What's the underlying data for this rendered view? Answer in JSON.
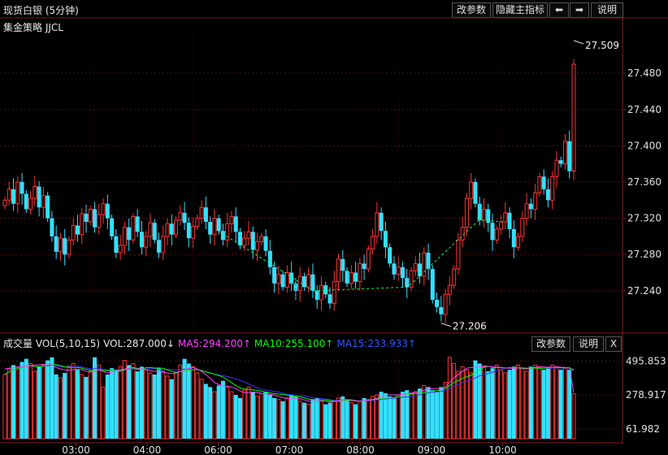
{
  "header": {
    "title": "现货白银 (5分钟)",
    "strategy": "集金策略 JJCL",
    "buttons": {
      "change_params": "改参数",
      "hide_indicator": "隐藏主指标",
      "prev": "⬅",
      "next": "➡",
      "help": "说明"
    }
  },
  "volume_header": {
    "label": "成交量 VOL(5,10,15)",
    "vol": "VOL:287.000↓",
    "ma5": "MA5:294.200↑",
    "ma10": "MA10:255.100↑",
    "ma15": "MA15:233.933↑",
    "buttons": {
      "change_params": "改参数",
      "help": "说明",
      "close": "X"
    }
  },
  "colors": {
    "up": "#ff3333",
    "down": "#33e0ff",
    "ma5": "#ff40ff",
    "ma10": "#00ff00",
    "ma15": "#3333ff",
    "signal": "#00ff66"
  },
  "chart_data": [
    {
      "type": "candlestick",
      "title": "现货白银 (5分钟)",
      "y_ticks": [
        "27.480",
        "27.440",
        "27.400",
        "27.360",
        "27.320",
        "27.280",
        "27.240"
      ],
      "ylim": [
        27.195,
        27.525
      ],
      "high_label": "27.509",
      "low_label": "27.206",
      "x_ticks": [
        "03:00",
        "04:00",
        "06:00",
        "07:00",
        "08:00",
        "09:00",
        "10:00"
      ],
      "close": [
        27.34,
        27.352,
        27.336,
        27.36,
        27.347,
        27.33,
        27.342,
        27.355,
        27.332,
        27.345,
        27.32,
        27.3,
        27.283,
        27.298,
        27.28,
        27.296,
        27.312,
        27.302,
        27.325,
        27.316,
        27.33,
        27.31,
        27.324,
        27.336,
        27.32,
        27.3,
        27.282,
        27.29,
        27.31,
        27.296,
        27.322,
        27.305,
        27.288,
        27.3,
        27.315,
        27.296,
        27.282,
        27.3,
        27.314,
        27.302,
        27.318,
        27.326,
        27.315,
        27.298,
        27.311,
        27.32,
        27.332,
        27.316,
        27.302,
        27.32,
        27.306,
        27.296,
        27.314,
        27.322,
        27.305,
        27.29,
        27.298,
        27.305,
        27.285,
        27.294,
        27.3,
        27.284,
        27.266,
        27.248,
        27.258,
        27.244,
        27.26,
        27.248,
        27.24,
        27.256,
        27.244,
        27.258,
        27.24,
        27.23,
        27.246,
        27.236,
        27.226,
        27.25,
        27.275,
        27.262,
        27.248,
        27.26,
        27.25,
        27.27,
        27.264,
        27.286,
        27.3,
        27.326,
        27.306,
        27.288,
        27.27,
        27.258,
        27.266,
        27.254,
        27.244,
        27.262,
        27.27,
        27.256,
        27.282,
        27.264,
        27.23,
        27.222,
        27.214,
        27.236,
        27.246,
        27.264,
        27.296,
        27.31,
        27.342,
        27.36,
        27.336,
        27.318,
        27.33,
        27.315,
        27.296,
        27.308,
        27.316,
        27.326,
        27.308,
        27.288,
        27.3,
        27.32,
        27.336,
        27.33,
        27.348,
        27.366,
        27.352,
        27.34,
        27.366,
        27.384,
        27.38,
        27.405,
        27.372,
        27.49
      ],
      "volume": {
        "y_ticks": [
          "495.853",
          "278.917",
          "61.982"
        ],
        "ylim": [
          0,
          560
        ],
        "values": [
          410,
          445,
          470,
          455,
          490,
          510,
          480,
          430,
          460,
          470,
          500,
          520,
          410,
          390,
          420,
          465,
          480,
          440,
          410,
          395,
          430,
          520,
          470,
          330,
          410,
          450,
          440,
          460,
          500,
          470,
          480,
          430,
          460,
          440,
          420,
          410,
          450,
          430,
          400,
          380,
          420,
          470,
          510,
          480,
          460,
          420,
          380,
          350,
          330,
          300,
          340,
          370,
          330,
          300,
          280,
          260,
          310,
          330,
          300,
          270,
          290,
          300,
          280,
          260,
          250,
          240,
          260,
          280,
          270,
          240,
          230,
          220,
          250,
          260,
          240,
          220,
          230,
          240,
          260,
          270,
          250,
          230,
          220,
          240,
          260,
          250,
          270,
          280,
          300,
          290,
          270,
          260,
          280,
          300,
          310,
          290,
          300,
          320,
          340,
          330,
          310,
          300,
          330,
          360,
          520,
          480,
          430,
          460,
          440,
          420,
          500,
          480,
          460,
          430,
          450,
          470,
          440,
          420,
          440,
          460,
          470,
          450,
          430,
          460,
          470,
          460,
          440,
          450,
          470,
          460,
          440,
          450,
          440,
          287
        ],
        "ma5": [
          445,
          450,
          455,
          458,
          460,
          462,
          465,
          470,
          472,
          475,
          478,
          470,
          455,
          445,
          440,
          438,
          440,
          445,
          440,
          430,
          425,
          430,
          440,
          430,
          420,
          425,
          430,
          440,
          445,
          450,
          455,
          450,
          445,
          440,
          435,
          430,
          428,
          425,
          420,
          415,
          418,
          428,
          440,
          450,
          455,
          445,
          430,
          410,
          385,
          360,
          345,
          340,
          335,
          330,
          320,
          305,
          295,
          295,
          298,
          295,
          290,
          288,
          284,
          278,
          270,
          262,
          258,
          258,
          260,
          255,
          248,
          240,
          238,
          240,
          242,
          238,
          236,
          238,
          242,
          248,
          250,
          248,
          244,
          240,
          242,
          246,
          250,
          258,
          268,
          276,
          280,
          280,
          280,
          284,
          288,
          292,
          296,
          300,
          310,
          318,
          320,
          320,
          322,
          330,
          360,
          390,
          410,
          430,
          450,
          455,
          455,
          460,
          465,
          462,
          458,
          456,
          455,
          452,
          450,
          450,
          452,
          452,
          450,
          452,
          455,
          458,
          458,
          456,
          456,
          458,
          456,
          455,
          452,
          294.2
        ]
      }
    }
  ]
}
